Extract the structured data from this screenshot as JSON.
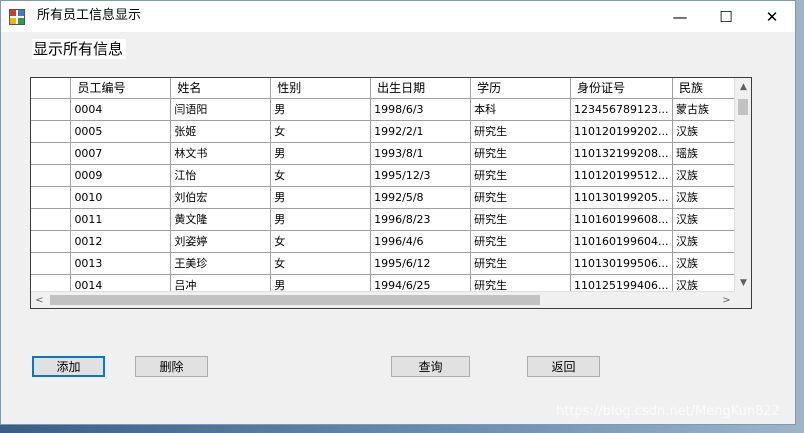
{
  "window": {
    "title": "所有员工信息显示",
    "minimize_glyph": "—",
    "maximize_glyph": "☐",
    "close_glyph": "✕"
  },
  "heading": "显示所有信息",
  "table": {
    "columns": [
      "员工编号",
      "姓名",
      "性别",
      "出生日期",
      "学历",
      "身份证号",
      "民族"
    ],
    "rows": [
      [
        "0004",
        "闫语阳",
        "男",
        "1998/6/3",
        "本科",
        "123456789123...",
        "蒙古族"
      ],
      [
        "0005",
        "张姬",
        "女",
        "1992/2/1",
        "研究生",
        "110120199202...",
        "汉族"
      ],
      [
        "0007",
        "林文书",
        "男",
        "1993/8/1",
        "研究生",
        "110132199208...",
        "瑶族"
      ],
      [
        "0009",
        "江怡",
        "女",
        "1995/12/3",
        "研究生",
        "110120199512...",
        "汉族"
      ],
      [
        "0010",
        "刘伯宏",
        "男",
        "1992/5/8",
        "研究生",
        "110130199205...",
        "汉族"
      ],
      [
        "0011",
        "黄文隆",
        "男",
        "1996/8/23",
        "研究生",
        "110160199608...",
        "汉族"
      ],
      [
        "0012",
        "刘姿婷",
        "女",
        "1996/4/6",
        "研究生",
        "110160199604...",
        "汉族"
      ],
      [
        "0013",
        "王美珍",
        "女",
        "1995/6/12",
        "研究生",
        "110130199506...",
        "汉族"
      ],
      [
        "0014",
        "吕冲",
        "男",
        "1994/6/25",
        "研究生",
        "110125199406...",
        "汉族"
      ]
    ]
  },
  "buttons": {
    "add": "添加",
    "delete": "删除",
    "query": "查询",
    "back": "返回"
  },
  "scroll_glyphs": {
    "up": "▲",
    "down": "▼",
    "left": "<",
    "right": ">"
  },
  "watermark": "https://blog.csdn.net/MengKun822",
  "colors": {
    "focus_border": "#0078d7",
    "grid_background": "#ababab"
  }
}
